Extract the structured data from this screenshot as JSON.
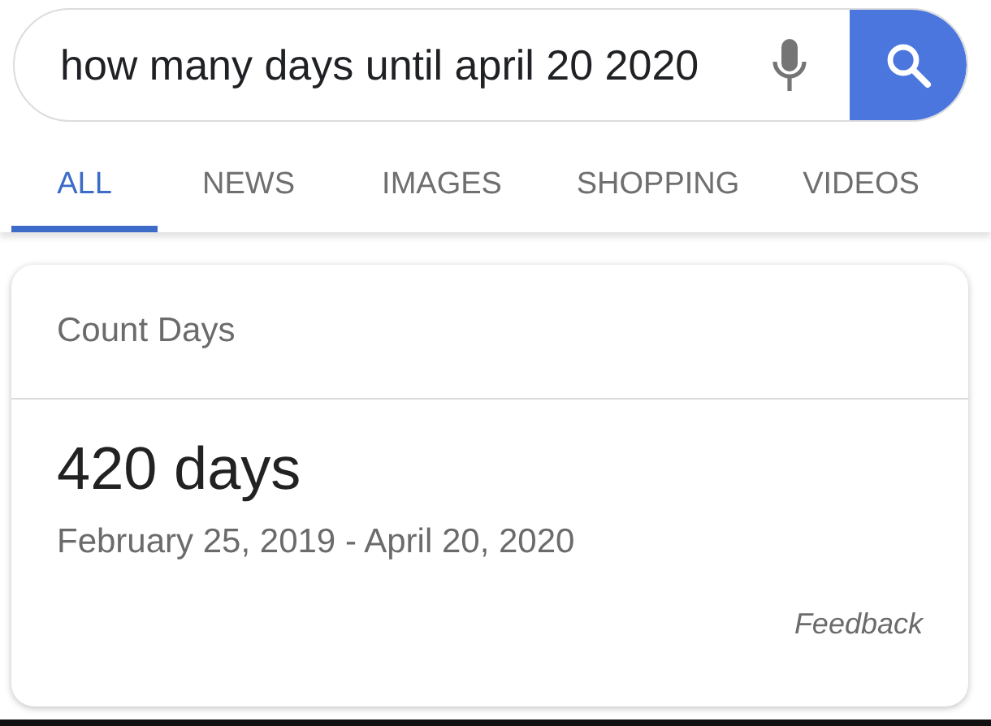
{
  "search": {
    "value": "how many days until april 20 2020"
  },
  "tabs": [
    {
      "label": "ALL",
      "selected": true
    },
    {
      "label": "NEWS",
      "selected": false
    },
    {
      "label": "IMAGES",
      "selected": false
    },
    {
      "label": "SHOPPING",
      "selected": false
    },
    {
      "label": "VIDEOS",
      "selected": false
    }
  ],
  "card": {
    "title": "Count Days",
    "result": "420 days",
    "range": "February 25, 2019 - April 20, 2020",
    "feedback": "Feedback"
  }
}
